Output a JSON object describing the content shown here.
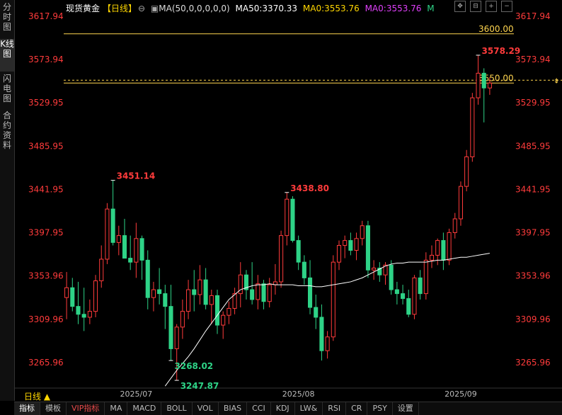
{
  "sidebar": {
    "tabs": [
      {
        "label": "分时图",
        "active": false
      },
      {
        "label": "K线图",
        "active": true
      },
      {
        "label": "闪电图",
        "active": false
      },
      {
        "label": "合约资料",
        "active": false
      }
    ]
  },
  "header": {
    "name": "现货黄金",
    "period": "【日线】",
    "ma_params": "MA(50,0,0,0,0,0)",
    "ma50": "MA50:3370.33",
    "ma0_a": "MA0:3553.76",
    "ma0_b": "MA0:3553.76",
    "m": "M"
  },
  "colors": {
    "up": "#ff3b3b",
    "down": "#2ed387",
    "ma": "#ffffff",
    "level_line": "#ffd54f",
    "label_red": "#ff3b3b",
    "label_green": "#2ed387"
  },
  "price_axis": {
    "ticks": [
      "3617.94",
      "3573.94",
      "3529.95",
      "3485.95",
      "3441.95",
      "3397.95",
      "3353.96",
      "3309.96",
      "3265.96"
    ]
  },
  "levels": [
    {
      "label": "3600.00",
      "value": 3600.0,
      "style": "solid"
    },
    {
      "label": "3550.00",
      "value": 3550.0,
      "style": "solid"
    }
  ],
  "annotations": [
    {
      "text": "3451.14",
      "value": 3451.14,
      "color": "red"
    },
    {
      "text": "3438.80",
      "value": 3438.8,
      "color": "red"
    },
    {
      "text": "3578.29",
      "value": 3578.29,
      "color": "red"
    },
    {
      "text": "3247.87",
      "value": 3247.87,
      "color": "green"
    },
    {
      "text": "3268.02",
      "value": 3268.02,
      "color": "green"
    }
  ],
  "date_axis": {
    "labels": [
      "2025/07",
      "2025/08",
      "2025/09"
    ]
  },
  "period_button": "日线 ▲",
  "bottom_bar": {
    "items": [
      "指标",
      "模板",
      "VIP指标",
      "MA",
      "MACD",
      "BOLL",
      "VOL",
      "BIAS",
      "CCI",
      "KDJ",
      "LW&",
      "RSI",
      "CR",
      "PSY",
      "设置"
    ]
  },
  "chart_data": {
    "type": "candlestick",
    "ylim": [
      3240,
      3620
    ],
    "candles": [
      {
        "o": 3332,
        "h": 3358,
        "l": 3310,
        "c": 3342
      },
      {
        "o": 3342,
        "h": 3352,
        "l": 3318,
        "c": 3323
      },
      {
        "o": 3323,
        "h": 3348,
        "l": 3305,
        "c": 3315
      },
      {
        "o": 3315,
        "h": 3342,
        "l": 3298,
        "c": 3312
      },
      {
        "o": 3312,
        "h": 3330,
        "l": 3305,
        "c": 3318
      },
      {
        "o": 3318,
        "h": 3355,
        "l": 3312,
        "c": 3349
      },
      {
        "o": 3349,
        "h": 3385,
        "l": 3342,
        "c": 3371
      },
      {
        "o": 3371,
        "h": 3428,
        "l": 3366,
        "c": 3422
      },
      {
        "o": 3422,
        "h": 3451,
        "l": 3385,
        "c": 3388
      },
      {
        "o": 3388,
        "h": 3405,
        "l": 3375,
        "c": 3395
      },
      {
        "o": 3395,
        "h": 3412,
        "l": 3372,
        "c": 3372
      },
      {
        "o": 3372,
        "h": 3395,
        "l": 3360,
        "c": 3368
      },
      {
        "o": 3368,
        "h": 3408,
        "l": 3352,
        "c": 3392
      },
      {
        "o": 3392,
        "h": 3395,
        "l": 3350,
        "c": 3370
      },
      {
        "o": 3370,
        "h": 3380,
        "l": 3320,
        "c": 3332
      },
      {
        "o": 3332,
        "h": 3348,
        "l": 3318,
        "c": 3340
      },
      {
        "o": 3340,
        "h": 3362,
        "l": 3325,
        "c": 3336
      },
      {
        "o": 3336,
        "h": 3345,
        "l": 3300,
        "c": 3323
      },
      {
        "o": 3323,
        "h": 3345,
        "l": 3268,
        "c": 3280
      },
      {
        "o": 3280,
        "h": 3305,
        "l": 3248,
        "c": 3302
      },
      {
        "o": 3302,
        "h": 3330,
        "l": 3290,
        "c": 3318
      },
      {
        "o": 3318,
        "h": 3350,
        "l": 3310,
        "c": 3340
      },
      {
        "o": 3340,
        "h": 3360,
        "l": 3318,
        "c": 3335
      },
      {
        "o": 3335,
        "h": 3365,
        "l": 3325,
        "c": 3350
      },
      {
        "o": 3350,
        "h": 3362,
        "l": 3320,
        "c": 3325
      },
      {
        "o": 3325,
        "h": 3340,
        "l": 3305,
        "c": 3334
      },
      {
        "o": 3334,
        "h": 3340,
        "l": 3295,
        "c": 3304
      },
      {
        "o": 3304,
        "h": 3318,
        "l": 3290,
        "c": 3314
      },
      {
        "o": 3314,
        "h": 3328,
        "l": 3305,
        "c": 3321
      },
      {
        "o": 3321,
        "h": 3342,
        "l": 3315,
        "c": 3336
      },
      {
        "o": 3336,
        "h": 3368,
        "l": 3322,
        "c": 3355
      },
      {
        "o": 3355,
        "h": 3360,
        "l": 3330,
        "c": 3340
      },
      {
        "o": 3340,
        "h": 3368,
        "l": 3325,
        "c": 3330
      },
      {
        "o": 3330,
        "h": 3355,
        "l": 3320,
        "c": 3346
      },
      {
        "o": 3346,
        "h": 3350,
        "l": 3320,
        "c": 3328
      },
      {
        "o": 3328,
        "h": 3352,
        "l": 3322,
        "c": 3345
      },
      {
        "o": 3345,
        "h": 3366,
        "l": 3335,
        "c": 3348
      },
      {
        "o": 3348,
        "h": 3400,
        "l": 3342,
        "c": 3395
      },
      {
        "o": 3395,
        "h": 3439,
        "l": 3385,
        "c": 3432
      },
      {
        "o": 3432,
        "h": 3435,
        "l": 3388,
        "c": 3390
      },
      {
        "o": 3390,
        "h": 3395,
        "l": 3360,
        "c": 3368
      },
      {
        "o": 3368,
        "h": 3375,
        "l": 3345,
        "c": 3352
      },
      {
        "o": 3352,
        "h": 3370,
        "l": 3315,
        "c": 3322
      },
      {
        "o": 3322,
        "h": 3335,
        "l": 3300,
        "c": 3312
      },
      {
        "o": 3312,
        "h": 3325,
        "l": 3268,
        "c": 3278
      },
      {
        "o": 3278,
        "h": 3298,
        "l": 3270,
        "c": 3292
      },
      {
        "o": 3292,
        "h": 3375,
        "l": 3288,
        "c": 3368
      },
      {
        "o": 3368,
        "h": 3390,
        "l": 3360,
        "c": 3385
      },
      {
        "o": 3385,
        "h": 3395,
        "l": 3372,
        "c": 3390
      },
      {
        "o": 3390,
        "h": 3398,
        "l": 3375,
        "c": 3380
      },
      {
        "o": 3380,
        "h": 3398,
        "l": 3370,
        "c": 3392
      },
      {
        "o": 3392,
        "h": 3410,
        "l": 3385,
        "c": 3405
      },
      {
        "o": 3405,
        "h": 3410,
        "l": 3352,
        "c": 3360
      },
      {
        "o": 3360,
        "h": 3370,
        "l": 3350,
        "c": 3362
      },
      {
        "o": 3362,
        "h": 3368,
        "l": 3348,
        "c": 3355
      },
      {
        "o": 3355,
        "h": 3368,
        "l": 3345,
        "c": 3365
      },
      {
        "o": 3365,
        "h": 3370,
        "l": 3335,
        "c": 3340
      },
      {
        "o": 3340,
        "h": 3348,
        "l": 3325,
        "c": 3336
      },
      {
        "o": 3336,
        "h": 3345,
        "l": 3325,
        "c": 3331
      },
      {
        "o": 3331,
        "h": 3340,
        "l": 3312,
        "c": 3315
      },
      {
        "o": 3315,
        "h": 3355,
        "l": 3310,
        "c": 3352
      },
      {
        "o": 3352,
        "h": 3360,
        "l": 3330,
        "c": 3336
      },
      {
        "o": 3336,
        "h": 3378,
        "l": 3330,
        "c": 3370
      },
      {
        "o": 3370,
        "h": 3385,
        "l": 3362,
        "c": 3375
      },
      {
        "o": 3375,
        "h": 3392,
        "l": 3365,
        "c": 3390
      },
      {
        "o": 3390,
        "h": 3398,
        "l": 3360,
        "c": 3370
      },
      {
        "o": 3370,
        "h": 3402,
        "l": 3365,
        "c": 3398
      },
      {
        "o": 3398,
        "h": 3418,
        "l": 3392,
        "c": 3412
      },
      {
        "o": 3412,
        "h": 3450,
        "l": 3405,
        "c": 3445
      },
      {
        "o": 3445,
        "h": 3482,
        "l": 3440,
        "c": 3475
      },
      {
        "o": 3475,
        "h": 3540,
        "l": 3470,
        "c": 3535
      },
      {
        "o": 3535,
        "h": 3578,
        "l": 3528,
        "c": 3560
      },
      {
        "o": 3560,
        "h": 3565,
        "l": 3510,
        "c": 3545
      },
      {
        "o": 3545,
        "h": 3556,
        "l": 3538,
        "c": 3550
      }
    ],
    "ma50": [
      3242,
      3250,
      3258,
      3265,
      3272,
      3280,
      3289,
      3298,
      3306,
      3314,
      3322,
      3330,
      3335,
      3340,
      3342,
      3344,
      3345,
      3345,
      3346,
      3345,
      3345,
      3345,
      3345,
      3344,
      3344,
      3344,
      3343,
      3343,
      3344,
      3345,
      3346,
      3347,
      3348,
      3350,
      3352,
      3355,
      3358,
      3361,
      3364,
      3366,
      3367,
      3367,
      3368,
      3368,
      3368,
      3368,
      3369,
      3370,
      3370,
      3371,
      3372,
      3373,
      3373,
      3374,
      3375,
      3376,
      3377
    ]
  }
}
